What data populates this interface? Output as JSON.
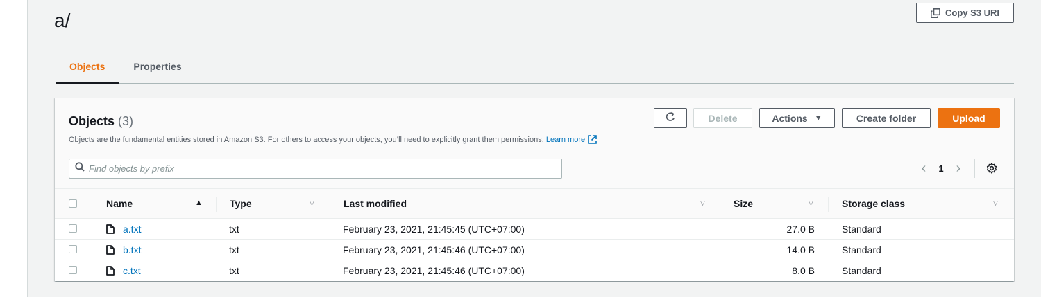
{
  "page": {
    "title": "a/",
    "copy_uri_label": "Copy S3 URI"
  },
  "tabs": [
    {
      "label": "Objects",
      "active": true
    },
    {
      "label": "Properties",
      "active": false
    }
  ],
  "panel": {
    "title": "Objects",
    "count": "(3)",
    "description": "Objects are the fundamental entities stored in Amazon S3. For others to access your objects, you’ll need to explicitly grant them permissions.",
    "learn_more": "Learn more",
    "buttons": {
      "refresh_icon": "refresh-icon",
      "delete": "Delete",
      "actions": "Actions",
      "create_folder": "Create folder",
      "upload": "Upload"
    },
    "search_placeholder": "Find objects by prefix",
    "pagination": {
      "current_page": "1"
    }
  },
  "table": {
    "columns": {
      "name": "Name",
      "type": "Type",
      "last_modified": "Last modified",
      "size": "Size",
      "storage_class": "Storage class"
    },
    "rows": [
      {
        "name": "a.txt",
        "type": "txt",
        "last_modified": "February 23, 2021, 21:45:45 (UTC+07:00)",
        "size": "27.0 B",
        "storage_class": "Standard"
      },
      {
        "name": "b.txt",
        "type": "txt",
        "last_modified": "February 23, 2021, 21:45:46 (UTC+07:00)",
        "size": "14.0 B",
        "storage_class": "Standard"
      },
      {
        "name": "c.txt",
        "type": "txt",
        "last_modified": "February 23, 2021, 21:45:46 (UTC+07:00)",
        "size": "8.0 B",
        "storage_class": "Standard"
      }
    ]
  },
  "colors": {
    "accent": "#ec7211",
    "link": "#0073bb",
    "text": "#16191f",
    "background": "#f2f3f3"
  }
}
